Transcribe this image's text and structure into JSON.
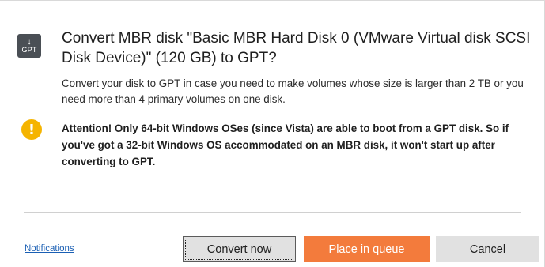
{
  "dialog": {
    "icon": {
      "arrow": "↓",
      "label": "GPT"
    },
    "title": "Convert MBR disk \"Basic MBR Hard Disk 0 (VMware Virtual disk SCSI Disk Device)\" (120 GB) to GPT?",
    "description": "Convert your disk to GPT in case you need to make volumes whose size is larger than 2 TB or you need more than 4 primary volumes on one disk.",
    "warning": {
      "icon": "!",
      "text": "Attention! Only 64-bit Windows OSes (since Vista) are able to boot from a GPT disk. So if you've got a 32-bit Windows OS accommodated on an MBR disk, it won't start up after converting to GPT."
    }
  },
  "footer": {
    "notifications_link": "Notifications",
    "convert_now_label": "Convert now",
    "place_in_queue_label": "Place in queue",
    "cancel_label": "Cancel"
  },
  "colors": {
    "accent": "#f37b3c",
    "warning": "#f5b400",
    "link": "#1a5fb4",
    "icon_bg": "#4a4f55"
  }
}
